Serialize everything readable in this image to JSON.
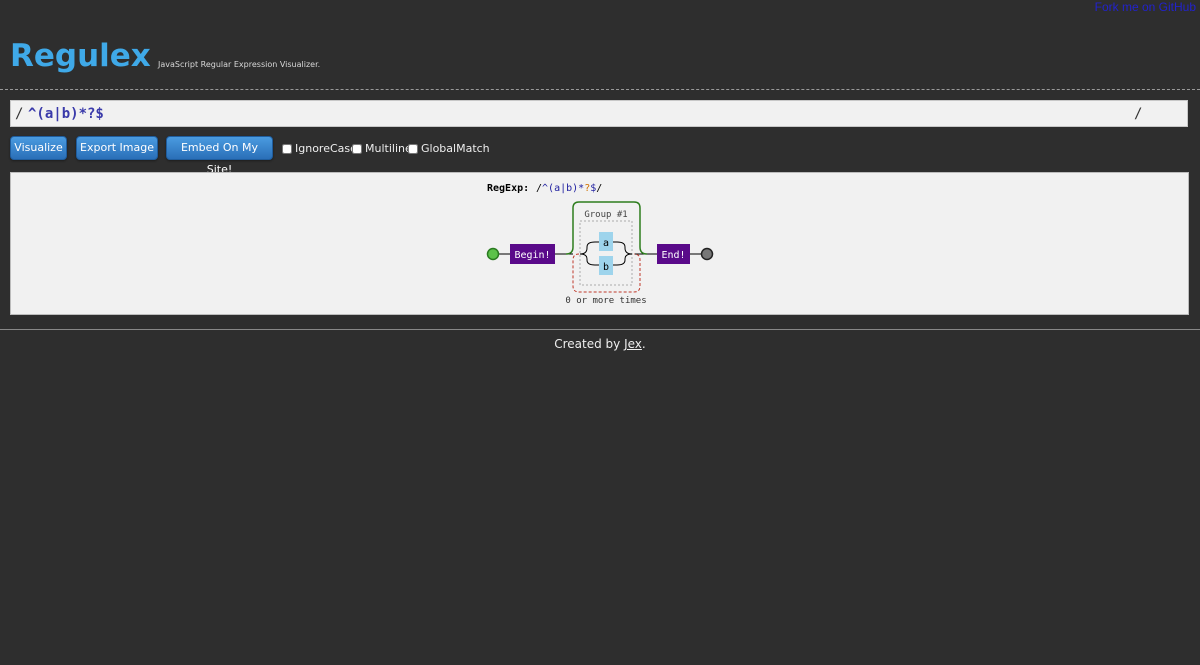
{
  "fork_link": "Fork me on GitHub",
  "header": {
    "logo": "Regulex",
    "subtitle": "JavaScript Regular Expression Visualizer."
  },
  "input": {
    "left_slash": "/",
    "right_slash": "/",
    "value": "^(a|b)*?$"
  },
  "buttons": {
    "visualize": "Visualize",
    "export": "Export Image",
    "embed": "Embed On My Site!"
  },
  "options": {
    "ignore_case": "IgnoreCase",
    "multiline": "Multiline",
    "global_match": "GlobalMatch"
  },
  "diagram": {
    "regexp_label": "RegExp:",
    "regexp_prefix": "/",
    "regexp_body": "^(a|b)*",
    "regexp_lazy": "?",
    "regexp_end": "$",
    "regexp_suffix": "/",
    "begin": "Begin!",
    "end": "End!",
    "group_label": "Group #1",
    "branch_a": "a",
    "branch_b": "b",
    "repeat_label": "0 or more times"
  },
  "footer": {
    "prefix": "Created by ",
    "author": "Jex",
    "suffix": "."
  },
  "colors": {
    "accent": "#3fa9e8",
    "background": "#2e2e2e",
    "node_purple": "#5a0a8a",
    "char_blue": "#9ed4ec",
    "group_green": "#2e7d1e",
    "repeat_red": "#c0392b"
  }
}
